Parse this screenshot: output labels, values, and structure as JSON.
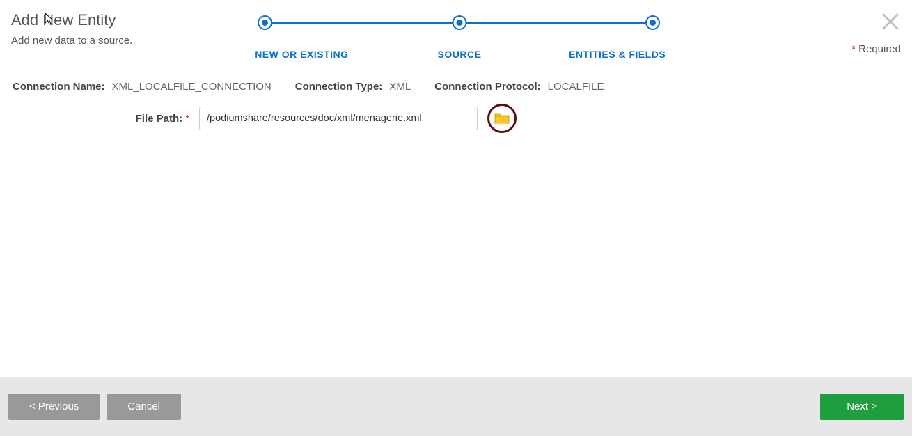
{
  "header": {
    "title": "Add New Entity",
    "subtitle": "Add new data to a source.",
    "required_label": "Required"
  },
  "stepper": {
    "steps": [
      "NEW OR EXISTING",
      "SOURCE",
      "ENTITIES & FIELDS"
    ]
  },
  "connection": {
    "name_label": "Connection Name:",
    "name_value": "XML_LOCALFILE_CONNECTION",
    "type_label": "Connection Type:",
    "type_value": "XML",
    "protocol_label": "Connection Protocol:",
    "protocol_value": "LOCALFILE"
  },
  "file_path": {
    "label": "File Path:",
    "value": "/podiumshare/resources/doc/xml/menagerie.xml"
  },
  "footer": {
    "previous": "< Previous",
    "cancel": "Cancel",
    "next": "Next >"
  }
}
